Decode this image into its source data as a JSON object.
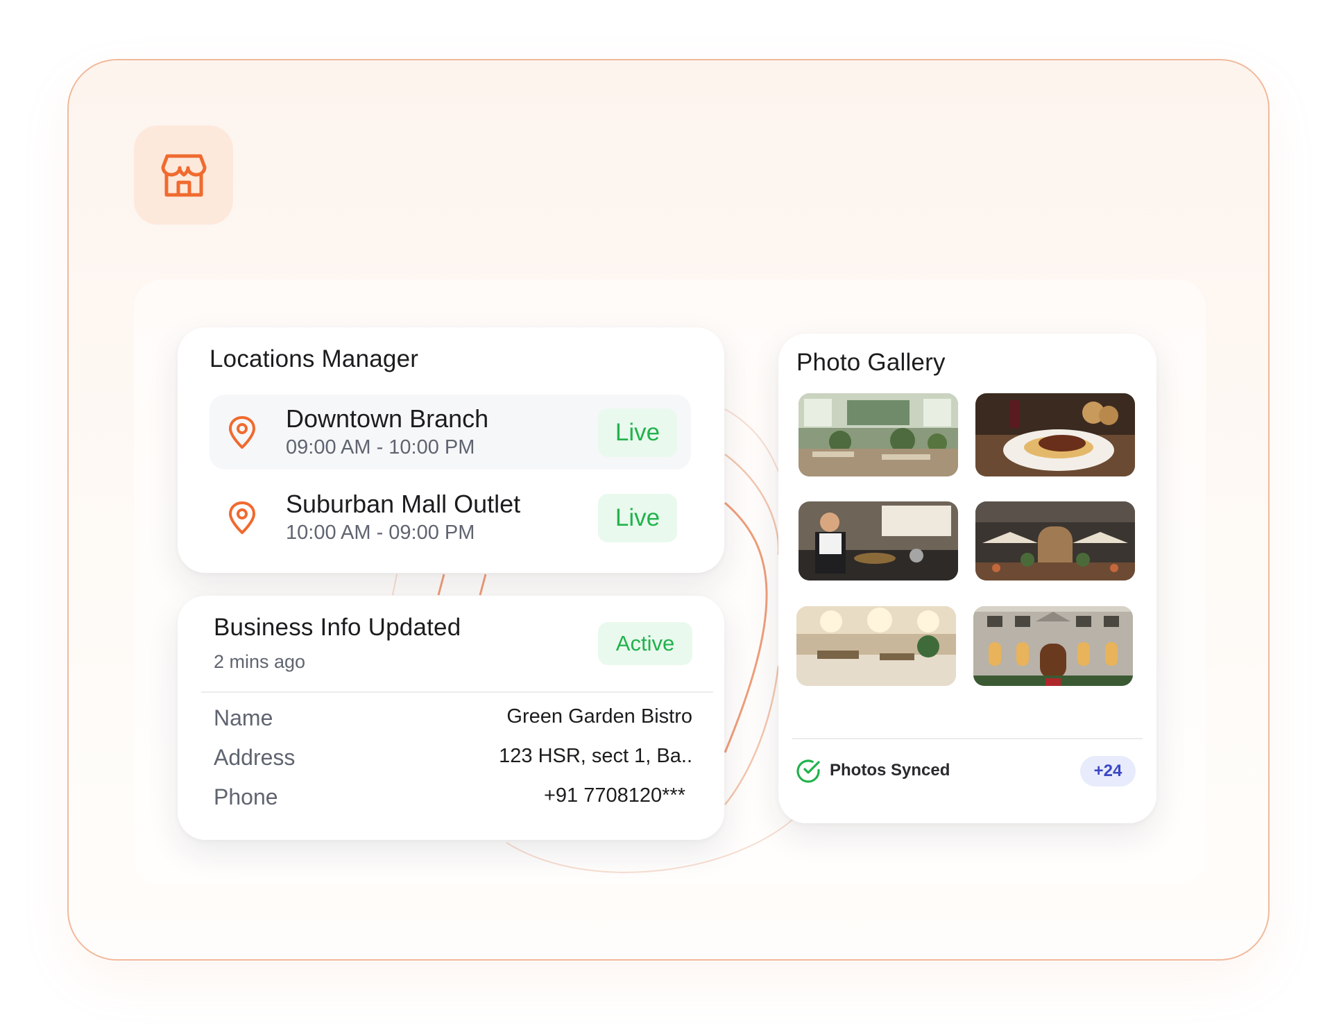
{
  "header": {
    "icon": "store-icon"
  },
  "locations": {
    "title": "Locations Manager",
    "items": [
      {
        "name": "Downtown Branch",
        "hours": "09:00 AM - 10:00 PM",
        "status": "Live",
        "icon": "location-pin-icon"
      },
      {
        "name": "Suburban Mall Outlet",
        "hours": "10:00 AM - 09:00 PM",
        "status": "Live",
        "icon": "location-pin-icon"
      }
    ]
  },
  "business": {
    "title": "Business Info Updated",
    "time": "2 mins ago",
    "status": "Active",
    "rows": [
      {
        "label": "Name",
        "value": "Green Garden Bistro"
      },
      {
        "label": "Address",
        "value": "123 HSR, sect 1, Ba.."
      },
      {
        "label": "Phone",
        "value": "+91 7708120***"
      }
    ]
  },
  "gallery": {
    "title": "Photo Gallery",
    "photos": [
      "restaurant-interior",
      "plated-dish",
      "chef-kitchen",
      "restaurant-exterior",
      "banquet-hall",
      "building-facade"
    ],
    "sync_label": "Photos Synced",
    "sync_icon": "check-circle-icon",
    "count": "+24"
  },
  "colors": {
    "accent": "#f06a2f",
    "live_green": "#22b24c",
    "count_blue": "#3a47c6"
  }
}
